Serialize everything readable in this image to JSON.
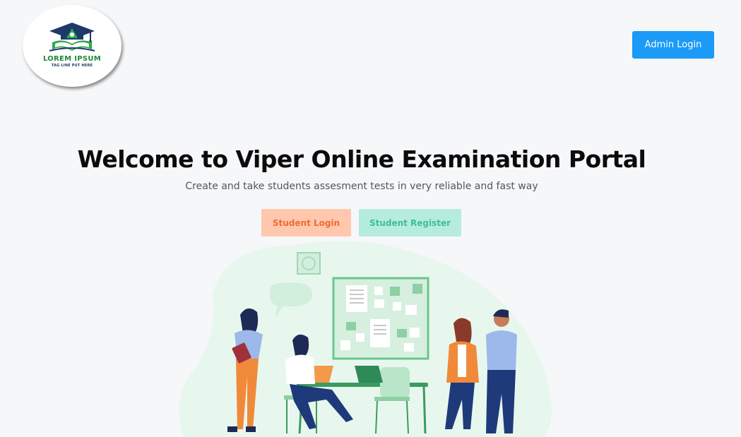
{
  "header": {
    "logo": {
      "title": "LOREM IPSUM",
      "tagline": "TAG LINE PUT HERE",
      "icon": "graduation-cap-book-icon"
    },
    "admin_login_label": "Admin Login"
  },
  "hero": {
    "title": "Welcome to Viper Online Examination Portal",
    "subtitle": "Create and take students assesment tests in very reliable and fast way",
    "student_login_label": "Student Login",
    "student_register_label": "Student Register"
  },
  "colors": {
    "background": "#f6f7f9",
    "admin_button": "#1b9af7",
    "student_login_bg": "#ffc7ad",
    "student_login_text": "#f26a2e",
    "student_register_bg": "#b6ecdb",
    "student_register_text": "#3cc094",
    "illustration_green": "#e8f7ee"
  }
}
